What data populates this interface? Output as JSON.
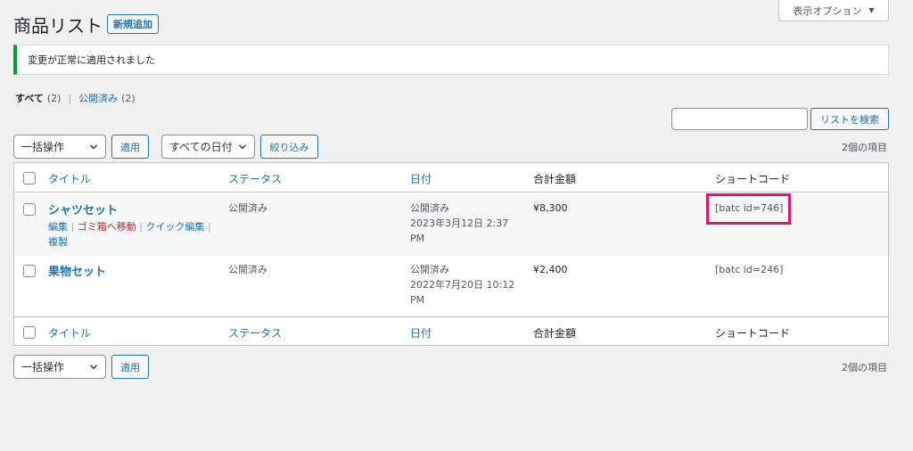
{
  "screen_options": {
    "label": "表示オプション"
  },
  "header": {
    "title": "商品リスト",
    "add_new": "新規追加"
  },
  "notice": {
    "message": "変更が正常に適用されました"
  },
  "views": {
    "all_label": "すべて",
    "all_count": "(2)",
    "separator": "|",
    "published_label": "公開済み",
    "published_count": "(2)"
  },
  "search": {
    "value": "",
    "button": "リストを検索"
  },
  "tablenav_top": {
    "bulk_action": "一括操作",
    "apply": "適用",
    "date_filter": "すべての日付",
    "filter": "絞り込み",
    "items_count": "2個の項目"
  },
  "tablenav_bottom": {
    "bulk_action": "一括操作",
    "apply": "適用",
    "items_count": "2個の項目"
  },
  "columns": {
    "title": "タイトル",
    "status": "ステータス",
    "date": "日付",
    "total": "合計金額",
    "shortcode": "ショートコード"
  },
  "rows": [
    {
      "title": "シャツセット",
      "actions": {
        "edit": "編集",
        "trash": "ゴミ箱へ移動",
        "quick_edit": "クイック編集",
        "duplicate": "複製",
        "sep": "|"
      },
      "status": "公開済み",
      "date_status": "公開済み",
      "date_line1": "2023年3月12日 2:37",
      "date_line2": "PM",
      "total": "¥8,300",
      "shortcode": "[batc id=746]"
    },
    {
      "title": "果物セット",
      "status": "公開済み",
      "date_status": "公開済み",
      "date_line1": "2022年7月20日 10:12",
      "date_line2": "PM",
      "total": "¥2,400",
      "shortcode": "[batc id=246]"
    }
  ],
  "colors": {
    "accent": "#2271b1",
    "success": "#00a32a",
    "highlight": "#e6136b",
    "danger": "#b32d2e"
  },
  "icons": {
    "select_caret": "chevron-down-icon",
    "screen_options_caret": "triangle-down-icon"
  }
}
